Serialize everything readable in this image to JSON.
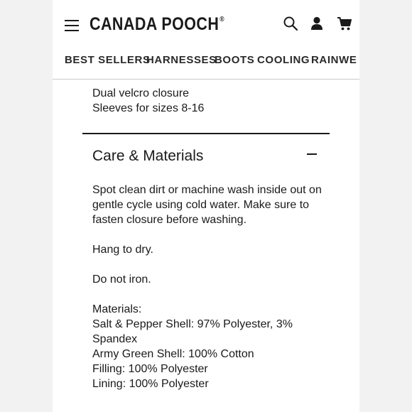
{
  "header": {
    "brand": "CANADA POOCH",
    "registered_mark": "®",
    "icons": [
      "menu-icon",
      "search-icon",
      "account-icon",
      "cart-icon"
    ]
  },
  "nav": {
    "items": [
      "BEST SELLERS",
      "HARNESSES",
      "BOOTS",
      "COOLING",
      "RAINWE"
    ]
  },
  "features": {
    "lines": [
      "Dual velcro closure",
      "Sleeves for sizes 8-16"
    ]
  },
  "care": {
    "title": "Care & Materials",
    "toggle_icon": "minus-icon",
    "wash_lines": [
      "Spot clean dirt or machine wash inside out on",
      "gentle cycle using cold water. Make sure to",
      "fasten closure before washing."
    ],
    "dry": "Hang to dry.",
    "iron": "Do not iron.",
    "materials_heading": "Materials:",
    "materials_lines": [
      "Salt & Pepper Shell: 97% Polyester, 3%",
      "Spandex",
      "Army Green Shell: 100% Cotton",
      "Filling: 100% Polyester",
      "Lining: 100% Polyester"
    ]
  }
}
